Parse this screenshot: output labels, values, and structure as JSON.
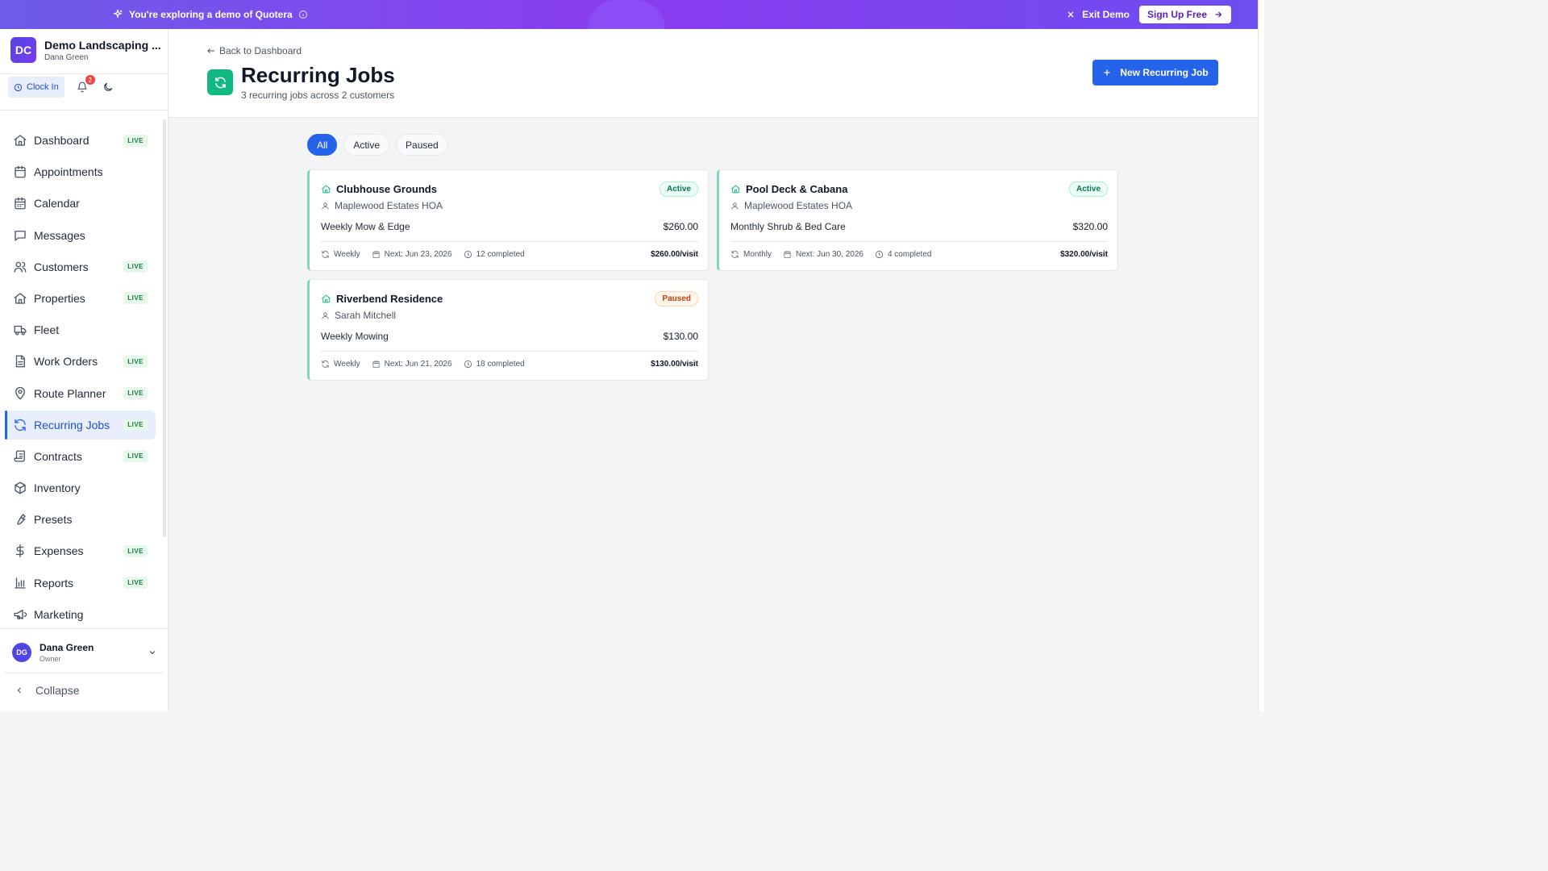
{
  "banner": {
    "text": "You're exploring a demo of Quotera",
    "exit_label": "Exit Demo",
    "signup_label": "Sign Up Free"
  },
  "org": {
    "initials": "DC",
    "name": "Demo Landscaping ...",
    "user": "Dana Green"
  },
  "tools": {
    "clock_in_label": "Clock In",
    "notification_count": "2"
  },
  "nav": {
    "items": [
      {
        "label": "Dashboard",
        "live": "LIVE",
        "icon": "home-icon"
      },
      {
        "label": "Appointments",
        "live": "",
        "icon": "calendar-icon"
      },
      {
        "label": "Calendar",
        "live": "",
        "icon": "calendar-grid-icon"
      },
      {
        "label": "Messages",
        "live": "",
        "icon": "message-icon"
      },
      {
        "label": "Customers",
        "live": "LIVE",
        "icon": "users-icon"
      },
      {
        "label": "Properties",
        "live": "LIVE",
        "icon": "home-icon"
      },
      {
        "label": "Fleet",
        "live": "",
        "icon": "truck-icon"
      },
      {
        "label": "Work Orders",
        "live": "LIVE",
        "icon": "document-icon"
      },
      {
        "label": "Route Planner",
        "live": "LIVE",
        "icon": "map-pin-icon"
      },
      {
        "label": "Recurring Jobs",
        "live": "LIVE",
        "icon": "refresh-icon",
        "active": true
      },
      {
        "label": "Contracts",
        "live": "LIVE",
        "icon": "scroll-icon"
      },
      {
        "label": "Inventory",
        "live": "",
        "icon": "package-icon"
      },
      {
        "label": "Presets",
        "live": "",
        "icon": "wrench-icon"
      },
      {
        "label": "Expenses",
        "live": "LIVE",
        "icon": "dollar-icon"
      },
      {
        "label": "Reports",
        "live": "LIVE",
        "icon": "bar-chart-icon"
      },
      {
        "label": "Marketing",
        "live": "",
        "icon": "megaphone-icon"
      }
    ]
  },
  "user": {
    "initials": "DG",
    "name": "Dana Green",
    "role": "Owner"
  },
  "collapse_label": "Collapse",
  "header": {
    "back_label": "Back to Dashboard",
    "title": "Recurring Jobs",
    "subtitle": "3 recurring jobs across 2 customers",
    "new_button_label": "New Recurring Job"
  },
  "filters": [
    "All",
    "Active",
    "Paused"
  ],
  "jobs": [
    {
      "name": "Clubhouse Grounds",
      "status": "Active",
      "customer": "Maplewood Estates HOA",
      "service": "Weekly Mow & Edge",
      "price": "$260.00",
      "frequency": "Weekly",
      "next": "Next: Jun 23, 2026",
      "completed": "12 completed",
      "rate": "$260.00/visit"
    },
    {
      "name": "Pool Deck & Cabana",
      "status": "Active",
      "customer": "Maplewood Estates HOA",
      "service": "Monthly Shrub & Bed Care",
      "price": "$320.00",
      "frequency": "Monthly",
      "next": "Next: Jun 30, 2026",
      "completed": "4 completed",
      "rate": "$320.00/visit"
    },
    {
      "name": "Riverbend Residence",
      "status": "Paused",
      "customer": "Sarah Mitchell",
      "service": "Weekly Mowing",
      "price": "$130.00",
      "frequency": "Weekly",
      "next": "Next: Jun 21, 2026",
      "completed": "18 completed",
      "rate": "$130.00/visit"
    }
  ],
  "colors": {
    "accent": "#2563eb",
    "banner_start": "#6d5ce8",
    "banner_mid": "#8b3cf0",
    "card_border": "#7dd9b8",
    "title_icon": "#10b981",
    "live_badge": "#15803d"
  }
}
